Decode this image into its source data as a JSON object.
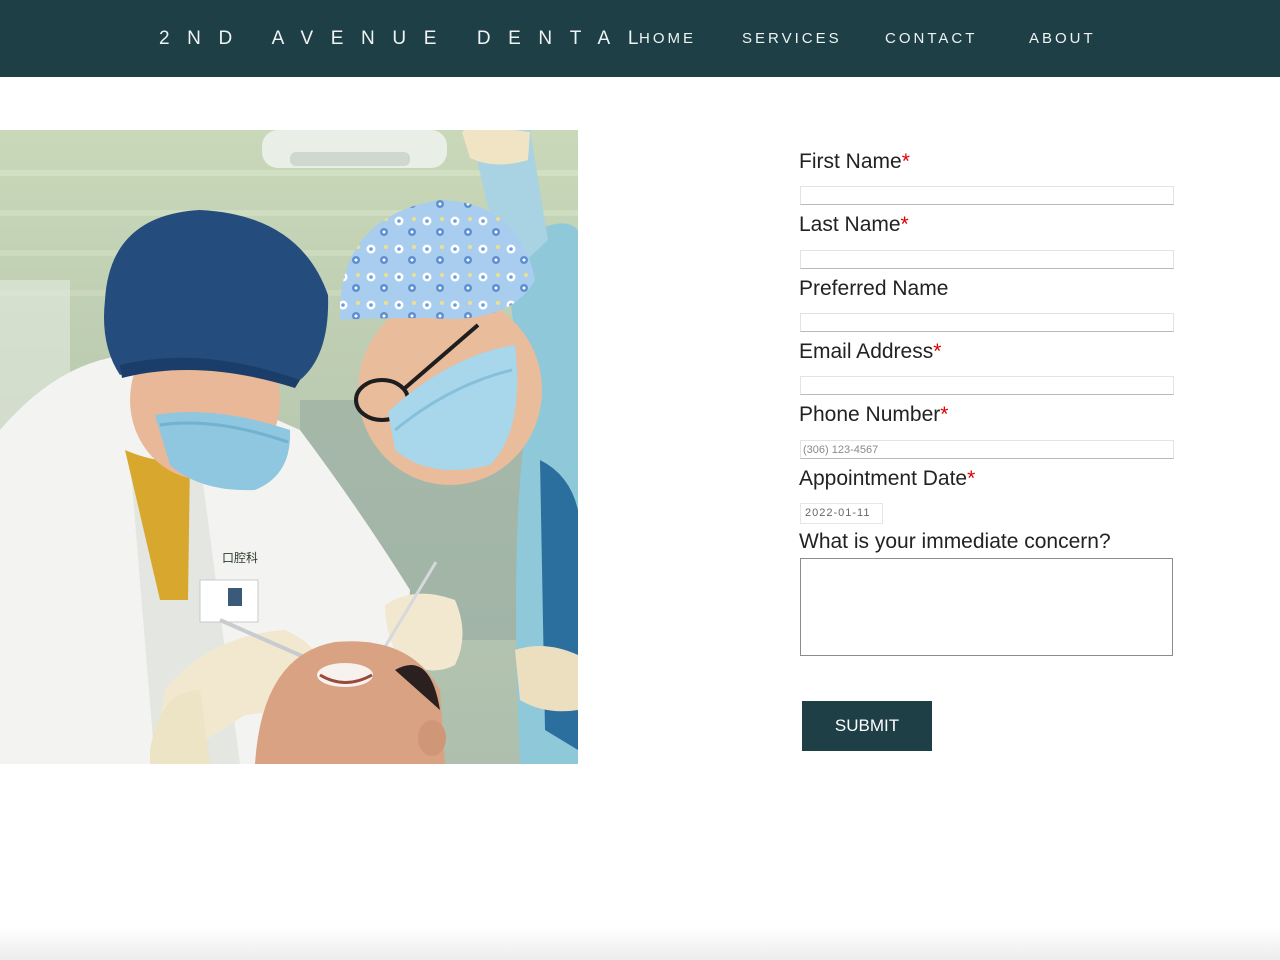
{
  "header": {
    "brand": "2ND AVENUE DENTAL",
    "nav": {
      "home": "HOME",
      "services": "SERVICES",
      "contact": "CONTACT",
      "about": "ABOUT"
    },
    "background_color": "#1e3f46"
  },
  "photo": {
    "icon": "dental-exam-photo",
    "badge_text": "口腔科"
  },
  "form": {
    "required_marker": "*",
    "first_name": {
      "label": "First Name",
      "required": true,
      "value": ""
    },
    "last_name": {
      "label": "Last Name",
      "required": true,
      "value": ""
    },
    "preferred_name": {
      "label": "Preferred Name",
      "required": false,
      "value": ""
    },
    "email": {
      "label": "Email Address",
      "required": true,
      "value": ""
    },
    "phone": {
      "label": "Phone Number",
      "required": true,
      "placeholder": "(306) 123-4567",
      "value": ""
    },
    "appointment_date": {
      "label": "Appointment Date",
      "required": true,
      "value": "2022-01-11"
    },
    "concern": {
      "label": "What is your immediate concern?",
      "value": ""
    },
    "submit_label": "SUBMIT"
  },
  "colors": {
    "accent": "#1e3f46",
    "required": "#e00000"
  }
}
